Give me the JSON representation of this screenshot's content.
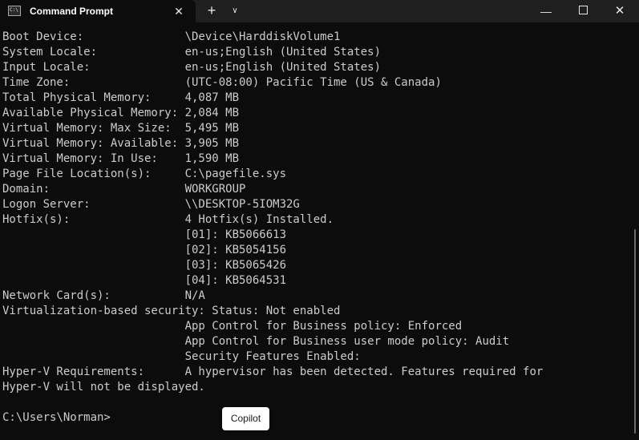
{
  "window": {
    "tab_title": "Command Prompt",
    "tab_icon_text": "C:\\",
    "close_tab_glyph": "✕",
    "new_tab_glyph": "+",
    "dropdown_glyph": "∨",
    "minimize_glyph": "—",
    "close_glyph": "✕"
  },
  "console": {
    "lines": [
      "Boot Device:               \\Device\\HarddiskVolume1",
      "System Locale:             en-us;English (United States)",
      "Input Locale:              en-us;English (United States)",
      "Time Zone:                 (UTC-08:00) Pacific Time (US & Canada)",
      "Total Physical Memory:     4,087 MB",
      "Available Physical Memory: 2,084 MB",
      "Virtual Memory: Max Size:  5,495 MB",
      "Virtual Memory: Available: 3,905 MB",
      "Virtual Memory: In Use:    1,590 MB",
      "Page File Location(s):     C:\\pagefile.sys",
      "Domain:                    WORKGROUP",
      "Logon Server:              \\\\DESKTOP-5IOM32G",
      "Hotfix(s):                 4 Hotfix(s) Installed.",
      "                           [01]: KB5066613",
      "                           [02]: KB5054156",
      "                           [03]: KB5065426",
      "                           [04]: KB5064531",
      "Network Card(s):           N/A",
      "Virtualization-based security: Status: Not enabled",
      "                           App Control for Business policy: Enforced",
      "                           App Control for Business user mode policy: Audit",
      "                           Security Features Enabled:",
      "Hyper-V Requirements:      A hypervisor has been detected. Features required for",
      "Hyper-V will not be displayed.",
      "",
      "C:\\Users\\Norman>"
    ]
  },
  "copilot_button": {
    "label": "Copilot"
  },
  "colors": {
    "console_bg": "#0c0c0c",
    "titlebar_bg": "#1f1f1f",
    "text": "#cccccc"
  }
}
